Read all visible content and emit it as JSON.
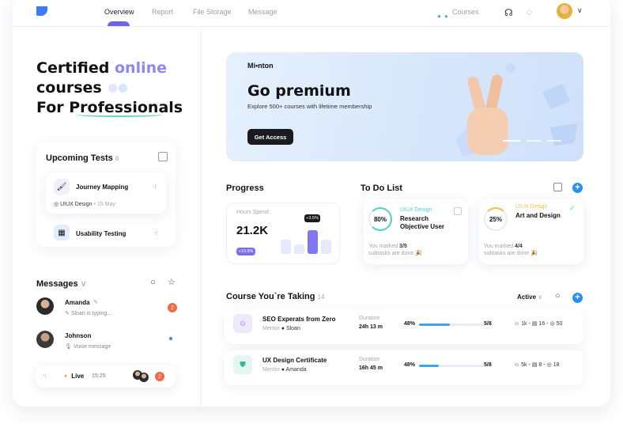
{
  "nav": {
    "tabs": [
      "Overview",
      "Report",
      "File Storage",
      "Message"
    ],
    "courses_label": "Courses"
  },
  "hero": {
    "line1_a": "Certified ",
    "line1_b": "online",
    "line2": "courses",
    "line3_a": "For ",
    "line3_b": "Professionals"
  },
  "upcoming": {
    "title": "Upcoming Tests",
    "count": "6",
    "tests": [
      {
        "name": "Journey Mapping",
        "tag": "UIUX Design",
        "date": "15 May"
      },
      {
        "name": "Usability Testing"
      }
    ]
  },
  "messages": {
    "title": "Messages",
    "items": [
      {
        "name": "Amanda",
        "status": "Sloan is typing...",
        "badge": "2"
      },
      {
        "name": "Johnson",
        "status": "Voise message"
      }
    ],
    "live": {
      "label": "Live",
      "time": "15:25",
      "badge": "2"
    }
  },
  "banner": {
    "brand": "Mi•nton",
    "title": "Go premium",
    "subtitle": "Explore 500+ courses with lifetime membership",
    "cta": "Get Access"
  },
  "progress": {
    "title": "Progress",
    "label": "Hours Spend",
    "value": "21.2K",
    "delta": "+10.9%",
    "tooltip": "+3.5%"
  },
  "todo": {
    "title": "To Do List",
    "items": [
      {
        "percent": "80%",
        "percent_value": 80,
        "tag": "UIUX Design",
        "title_l1": "Research",
        "title_l2": "Objective User",
        "marked_prefix": "You marked ",
        "marked_count": "3/5",
        "marked_suffix": "subtasks are done 🎉",
        "ring_color": "#4fd1c5"
      },
      {
        "percent": "25%",
        "percent_value": 25,
        "tag": "UIUX Design",
        "title_l1": "Art and Design",
        "title_l2": "",
        "marked_prefix": "You marked ",
        "marked_count": "4/4",
        "marked_suffix": "subtasks are done 🎉",
        "ring_color": "#f5c048"
      }
    ]
  },
  "taking": {
    "title": "Course You`re Taking",
    "count": "14",
    "filter": "Active",
    "rows": [
      {
        "name": "SEO Experats from Zero",
        "mentor_label": "Mentor",
        "mentor": "Sloan",
        "duration_label": "Duration",
        "duration": "24h 13 m",
        "percent": "48%",
        "fill": 0.48,
        "fraction": "5/8",
        "stats": [
          "1k",
          "16",
          "50"
        ]
      },
      {
        "name": "UX Design Certificate",
        "mentor_label": "Mentor",
        "mentor": "Amanda",
        "duration_label": "Duration",
        "duration": "16h 45 m",
        "percent": "48%",
        "fill": 0.3,
        "fraction": "5/8",
        "stats": [
          "5k",
          "8",
          "18"
        ]
      }
    ]
  },
  "colors": {
    "accent": "#8f86f5",
    "primary": "#2c8ef0",
    "badge": "#f06b46"
  }
}
